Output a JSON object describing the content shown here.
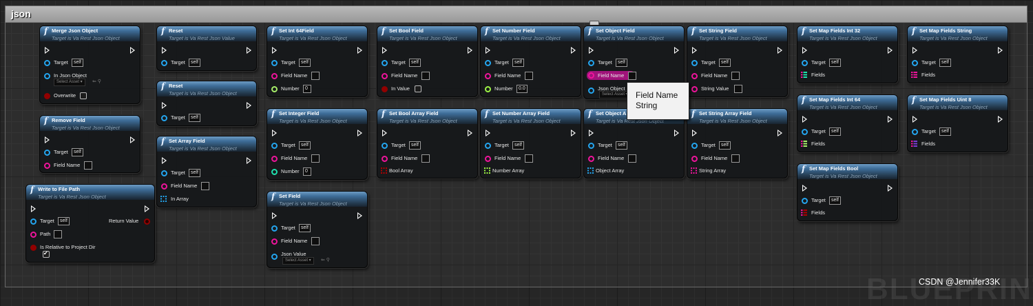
{
  "comment": {
    "title": "json"
  },
  "tooltip": {
    "line1": "Field Name",
    "line2": "String"
  },
  "watermark": "CSDN @Jennifer33K",
  "bp_mark": "BLUEPRINT",
  "common": {
    "self": "self",
    "select_asset": "Select Asset ▾",
    "asset_icons": "⇐ ⚲",
    "func_icon": "f"
  },
  "colors": {
    "object": "#24a6f0",
    "string": "#f0149c",
    "bool": "#920101",
    "int": "#1fe3b0",
    "int64": "#a8f06a",
    "float": "#9ef546",
    "header": "#3e6d98"
  },
  "nodes": {
    "merge_json_object": {
      "title": "Merge Json Object",
      "subtitle": "Target is Va Rest Json Object",
      "target": "Target",
      "in_json_object": "In Json Object",
      "overwrite": "Overwrite",
      "overwrite_checked": false
    },
    "remove_field": {
      "title": "Remove Field",
      "subtitle": "Target is Va Rest Json Object",
      "target": "Target",
      "field_name": "Field Name"
    },
    "write_to_file_path": {
      "title": "Write to File Path",
      "subtitle": "Target is Va Rest Json Object",
      "target": "Target",
      "path": "Path",
      "is_relative": "Is Relative to Project Dir",
      "is_relative_checked": true,
      "return_value": "Return Value"
    },
    "reset_1": {
      "title": "Reset",
      "subtitle": "Target is Va Rest Json Value",
      "target": "Target"
    },
    "reset_2": {
      "title": "Reset",
      "subtitle": "Target is Va Rest Json Object",
      "target": "Target"
    },
    "set_array_field": {
      "title": "Set Array Field",
      "subtitle": "Target is Va Rest Json Object",
      "target": "Target",
      "field_name": "Field Name",
      "in_array": "In Array"
    },
    "set_int64_field": {
      "title": "Set Int 64Field",
      "subtitle": "Target is Va Rest Json Object",
      "target": "Target",
      "field_name": "Field Name",
      "number": "Number",
      "number_value": "0"
    },
    "set_integer_field": {
      "title": "Set Integer Field",
      "subtitle": "Target is Va Rest Json Object",
      "target": "Target",
      "field_name": "Field Name",
      "number": "Number",
      "number_value": "0"
    },
    "set_field": {
      "title": "Set Field",
      "subtitle": "Target is Va Rest Json Object",
      "target": "Target",
      "field_name": "Field Name",
      "json_value": "Json Value"
    },
    "set_bool_field": {
      "title": "Set Bool Field",
      "subtitle": "Target is Va Rest Json Object",
      "target": "Target",
      "field_name": "Field Name",
      "in_value": "In Value",
      "in_value_checked": false
    },
    "set_bool_array_field": {
      "title": "Set Bool Array Field",
      "subtitle": "Target is Va Rest Json Object",
      "target": "Target",
      "field_name": "Field Name",
      "array": "Bool Array"
    },
    "set_number_field": {
      "title": "Set Number Field",
      "subtitle": "Target is Va Rest Json Object",
      "target": "Target",
      "field_name": "Field Name",
      "number": "Number",
      "number_value": "0.0"
    },
    "set_number_array_field": {
      "title": "Set Number Array Field",
      "subtitle": "Target is Va Rest Json Object",
      "target": "Target",
      "field_name": "Field Name",
      "array": "Number Array"
    },
    "set_object_field": {
      "title": "Set Object Field",
      "subtitle": "Target is Va Rest Json Object",
      "target": "Target",
      "field_name": "Field Name",
      "json_object": "Json Object"
    },
    "set_object_array_field": {
      "title": "Set Object A",
      "subtitle": "Target is Va Rest Json Object",
      "target": "Target",
      "field_name": "Field Name",
      "array": "Object Array"
    },
    "set_string_field": {
      "title": "Set String Field",
      "subtitle": "Target is Va Rest Json Object",
      "target": "Target",
      "field_name": "Field Name",
      "string_value": "String Value"
    },
    "set_string_array_field": {
      "title": "Set String Array Field",
      "subtitle": "Target is Va Rest Json Object",
      "target": "Target",
      "field_name": "Field Name",
      "array": "String Array"
    },
    "set_map_fields_int32": {
      "title": "Set Map Fields Int 32",
      "subtitle": "Target is Va Rest Json Object",
      "target": "Target",
      "fields": "Fields"
    },
    "set_map_fields_int64": {
      "title": "Set Map Fields Int 64",
      "subtitle": "Target is Va Rest Json Object",
      "target": "Target",
      "fields": "Fields"
    },
    "set_map_fields_bool": {
      "title": "Set Map Fields Bool",
      "subtitle": "Target is Va Rest Json Object",
      "target": "Target",
      "fields": "Fields"
    },
    "set_map_fields_string": {
      "title": "Set Map Fields String",
      "subtitle": "Target is Va Rest Json Object",
      "target": "Target",
      "fields": "Fields"
    },
    "set_map_fields_uint8": {
      "title": "Set Map Fields Uint 8",
      "subtitle": "Target is Va Rest Json Object",
      "target": "Target",
      "fields": "Fields"
    }
  }
}
